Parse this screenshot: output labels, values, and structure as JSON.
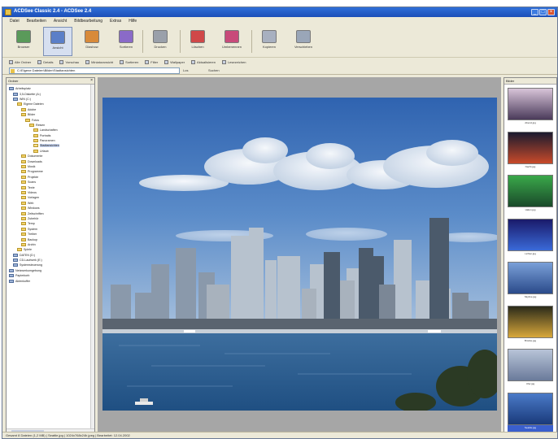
{
  "window": {
    "title": "ACDSee Classic 2.4 - ACDSee 2.4"
  },
  "menu": [
    "Datei",
    "Bearbeiten",
    "Ansicht",
    "Bildbearbeitung",
    "Extras",
    "Hilfe"
  ],
  "toolbar": [
    {
      "label": "Browser",
      "icon": "browser-icon",
      "color": "#5a9a5a"
    },
    {
      "label": "Ansicht",
      "icon": "view-icon",
      "color": "#5b7fc8"
    },
    {
      "label": "Diashow",
      "icon": "slideshow-icon",
      "color": "#d88a3a"
    },
    {
      "label": "Sortieren",
      "icon": "sort-icon",
      "color": "#8a6ac8"
    },
    {
      "label": "Drucken",
      "icon": "print-icon",
      "color": "#9aa0aa"
    },
    {
      "label": "Löschen",
      "icon": "delete-icon",
      "color": "#d04848"
    },
    {
      "label": "Umbenennen",
      "icon": "rename-icon",
      "color": "#c84a7a"
    },
    {
      "label": "Kopieren",
      "icon": "copy-icon",
      "color": "#a8b0c0"
    },
    {
      "label": "Verschieben",
      "icon": "move-icon",
      "color": "#9aa6b8"
    }
  ],
  "toolbar2": [
    "Alle Ordner",
    "Details",
    "Vorschau",
    "Miniaturansicht",
    "Sortieren",
    "Filter",
    "Wallpaper",
    "Aktualisieren",
    "Lesezeichen"
  ],
  "address": {
    "value": "C:\\Eigene Dateien\\Bilder\\Stadtansichten",
    "go_label": "Los",
    "find_label": "Suchen"
  },
  "folders": {
    "header": "Ordner",
    "items": [
      {
        "label": "Arbeitsplatz",
        "indent": 0,
        "kind": "pc"
      },
      {
        "label": "3,5-Diskette (A:)",
        "indent": 1,
        "kind": "pc"
      },
      {
        "label": "WIN (C:)",
        "indent": 1,
        "kind": "pc"
      },
      {
        "label": "Eigene Dateien",
        "indent": 2,
        "kind": "folder"
      },
      {
        "label": "Adobe",
        "indent": 3,
        "kind": "folder"
      },
      {
        "label": "Bilder",
        "indent": 3,
        "kind": "folder"
      },
      {
        "label": "Fotos",
        "indent": 4,
        "kind": "folder"
      },
      {
        "label": "Reisen",
        "indent": 5,
        "kind": "folder"
      },
      {
        "label": "Landschaften",
        "indent": 6,
        "kind": "folder"
      },
      {
        "label": "Portraits",
        "indent": 6,
        "kind": "folder"
      },
      {
        "label": "Panoramen",
        "indent": 6,
        "kind": "folder"
      },
      {
        "label": "Stadtansichten",
        "indent": 6,
        "kind": "folder",
        "selected": true
      },
      {
        "label": "Urlaub",
        "indent": 6,
        "kind": "folder"
      },
      {
        "label": "Dokumente",
        "indent": 3,
        "kind": "folder"
      },
      {
        "label": "Downloads",
        "indent": 3,
        "kind": "folder"
      },
      {
        "label": "Musik",
        "indent": 3,
        "kind": "folder"
      },
      {
        "label": "Programme",
        "indent": 3,
        "kind": "folder"
      },
      {
        "label": "Projekte",
        "indent": 3,
        "kind": "folder"
      },
      {
        "label": "Scans",
        "indent": 3,
        "kind": "folder"
      },
      {
        "label": "Texte",
        "indent": 3,
        "kind": "folder"
      },
      {
        "label": "Videos",
        "indent": 3,
        "kind": "folder"
      },
      {
        "label": "Vorlagen",
        "indent": 3,
        "kind": "folder"
      },
      {
        "label": "Web",
        "indent": 3,
        "kind": "folder"
      },
      {
        "label": "Windows",
        "indent": 3,
        "kind": "folder"
      },
      {
        "label": "Zeitschriften",
        "indent": 3,
        "kind": "folder"
      },
      {
        "label": "Zubehör",
        "indent": 3,
        "kind": "folder"
      },
      {
        "label": "Temp",
        "indent": 3,
        "kind": "folder"
      },
      {
        "label": "System",
        "indent": 3,
        "kind": "folder"
      },
      {
        "label": "Treiber",
        "indent": 3,
        "kind": "folder"
      },
      {
        "label": "Backup",
        "indent": 3,
        "kind": "folder"
      },
      {
        "label": "Archiv",
        "indent": 3,
        "kind": "folder"
      },
      {
        "label": "Spiele",
        "indent": 2,
        "kind": "folder"
      },
      {
        "label": "DATEN (D:)",
        "indent": 1,
        "kind": "pc"
      },
      {
        "label": "CD-Laufwerk (E:)",
        "indent": 1,
        "kind": "pc"
      },
      {
        "label": "Systemsteuerung",
        "indent": 1,
        "kind": "pc"
      },
      {
        "label": "Netzwerkumgebung",
        "indent": 0,
        "kind": "pc"
      },
      {
        "label": "Papierkorb",
        "indent": 0,
        "kind": "pc"
      },
      {
        "label": "Aktenkoffer",
        "indent": 0,
        "kind": "pc"
      }
    ]
  },
  "thumbnails": {
    "header": "Bilder",
    "items": [
      {
        "caption": "Abend.jpg",
        "top": "#d8c4d8",
        "bottom": "#4a3a5a"
      },
      {
        "caption": "Nacht.jpg",
        "top": "#1a1a2e",
        "bottom": "#c84a2a"
      },
      {
        "caption": "Hafen.jpg",
        "top": "#3aa84a",
        "bottom": "#1a4a2a"
      },
      {
        "caption": "Lichter.jpg",
        "top": "#1a1a6a",
        "bottom": "#3a6ad8"
      },
      {
        "caption": "Skyline.jpg",
        "top": "#7aa0d8",
        "bottom": "#2a4a8a"
      },
      {
        "caption": "Brücke.jpg",
        "top": "#2a2a1a",
        "bottom": "#d8a83a"
      },
      {
        "caption": "Ufer.jpg",
        "top": "#b8c4d8",
        "bottom": "#6a7a9a"
      },
      {
        "caption": "Seattle.jpg",
        "top": "#4a7ac8",
        "bottom": "#1a3a7a",
        "selected": true
      }
    ]
  },
  "status": "Gesamt 8 Dateien (1,2 MB)  |  Seattle.jpg  |  1024x768x24b jpeg  |  Bearbeitet: 12.04.2002"
}
